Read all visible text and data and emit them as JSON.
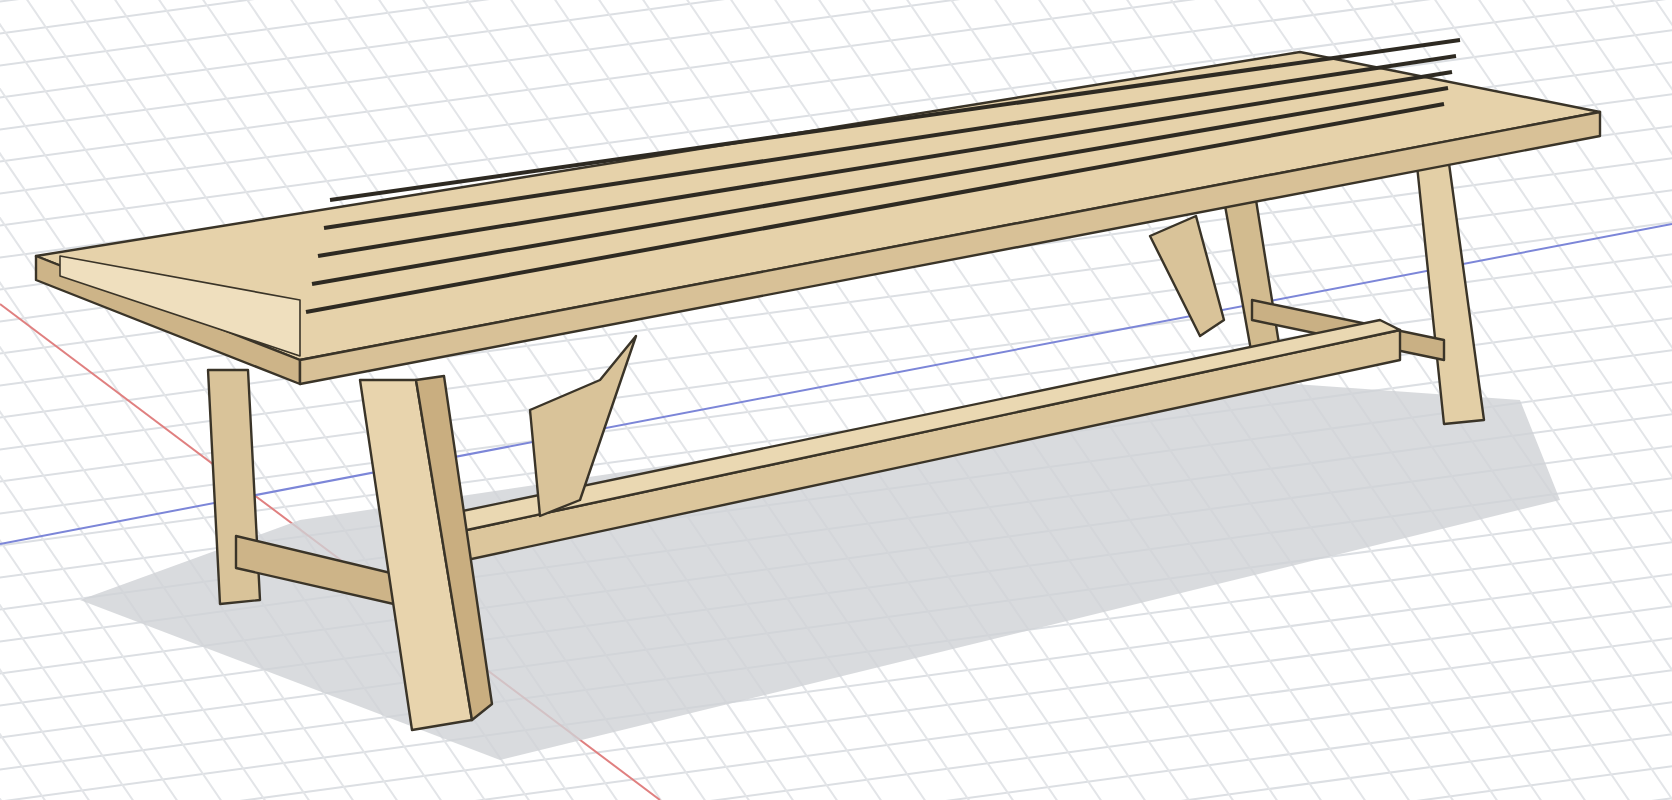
{
  "viewport": {
    "grid": {
      "shown": true
    },
    "axes": {
      "shown": true
    },
    "model": {
      "kind": "bench",
      "shadow": true
    }
  }
}
